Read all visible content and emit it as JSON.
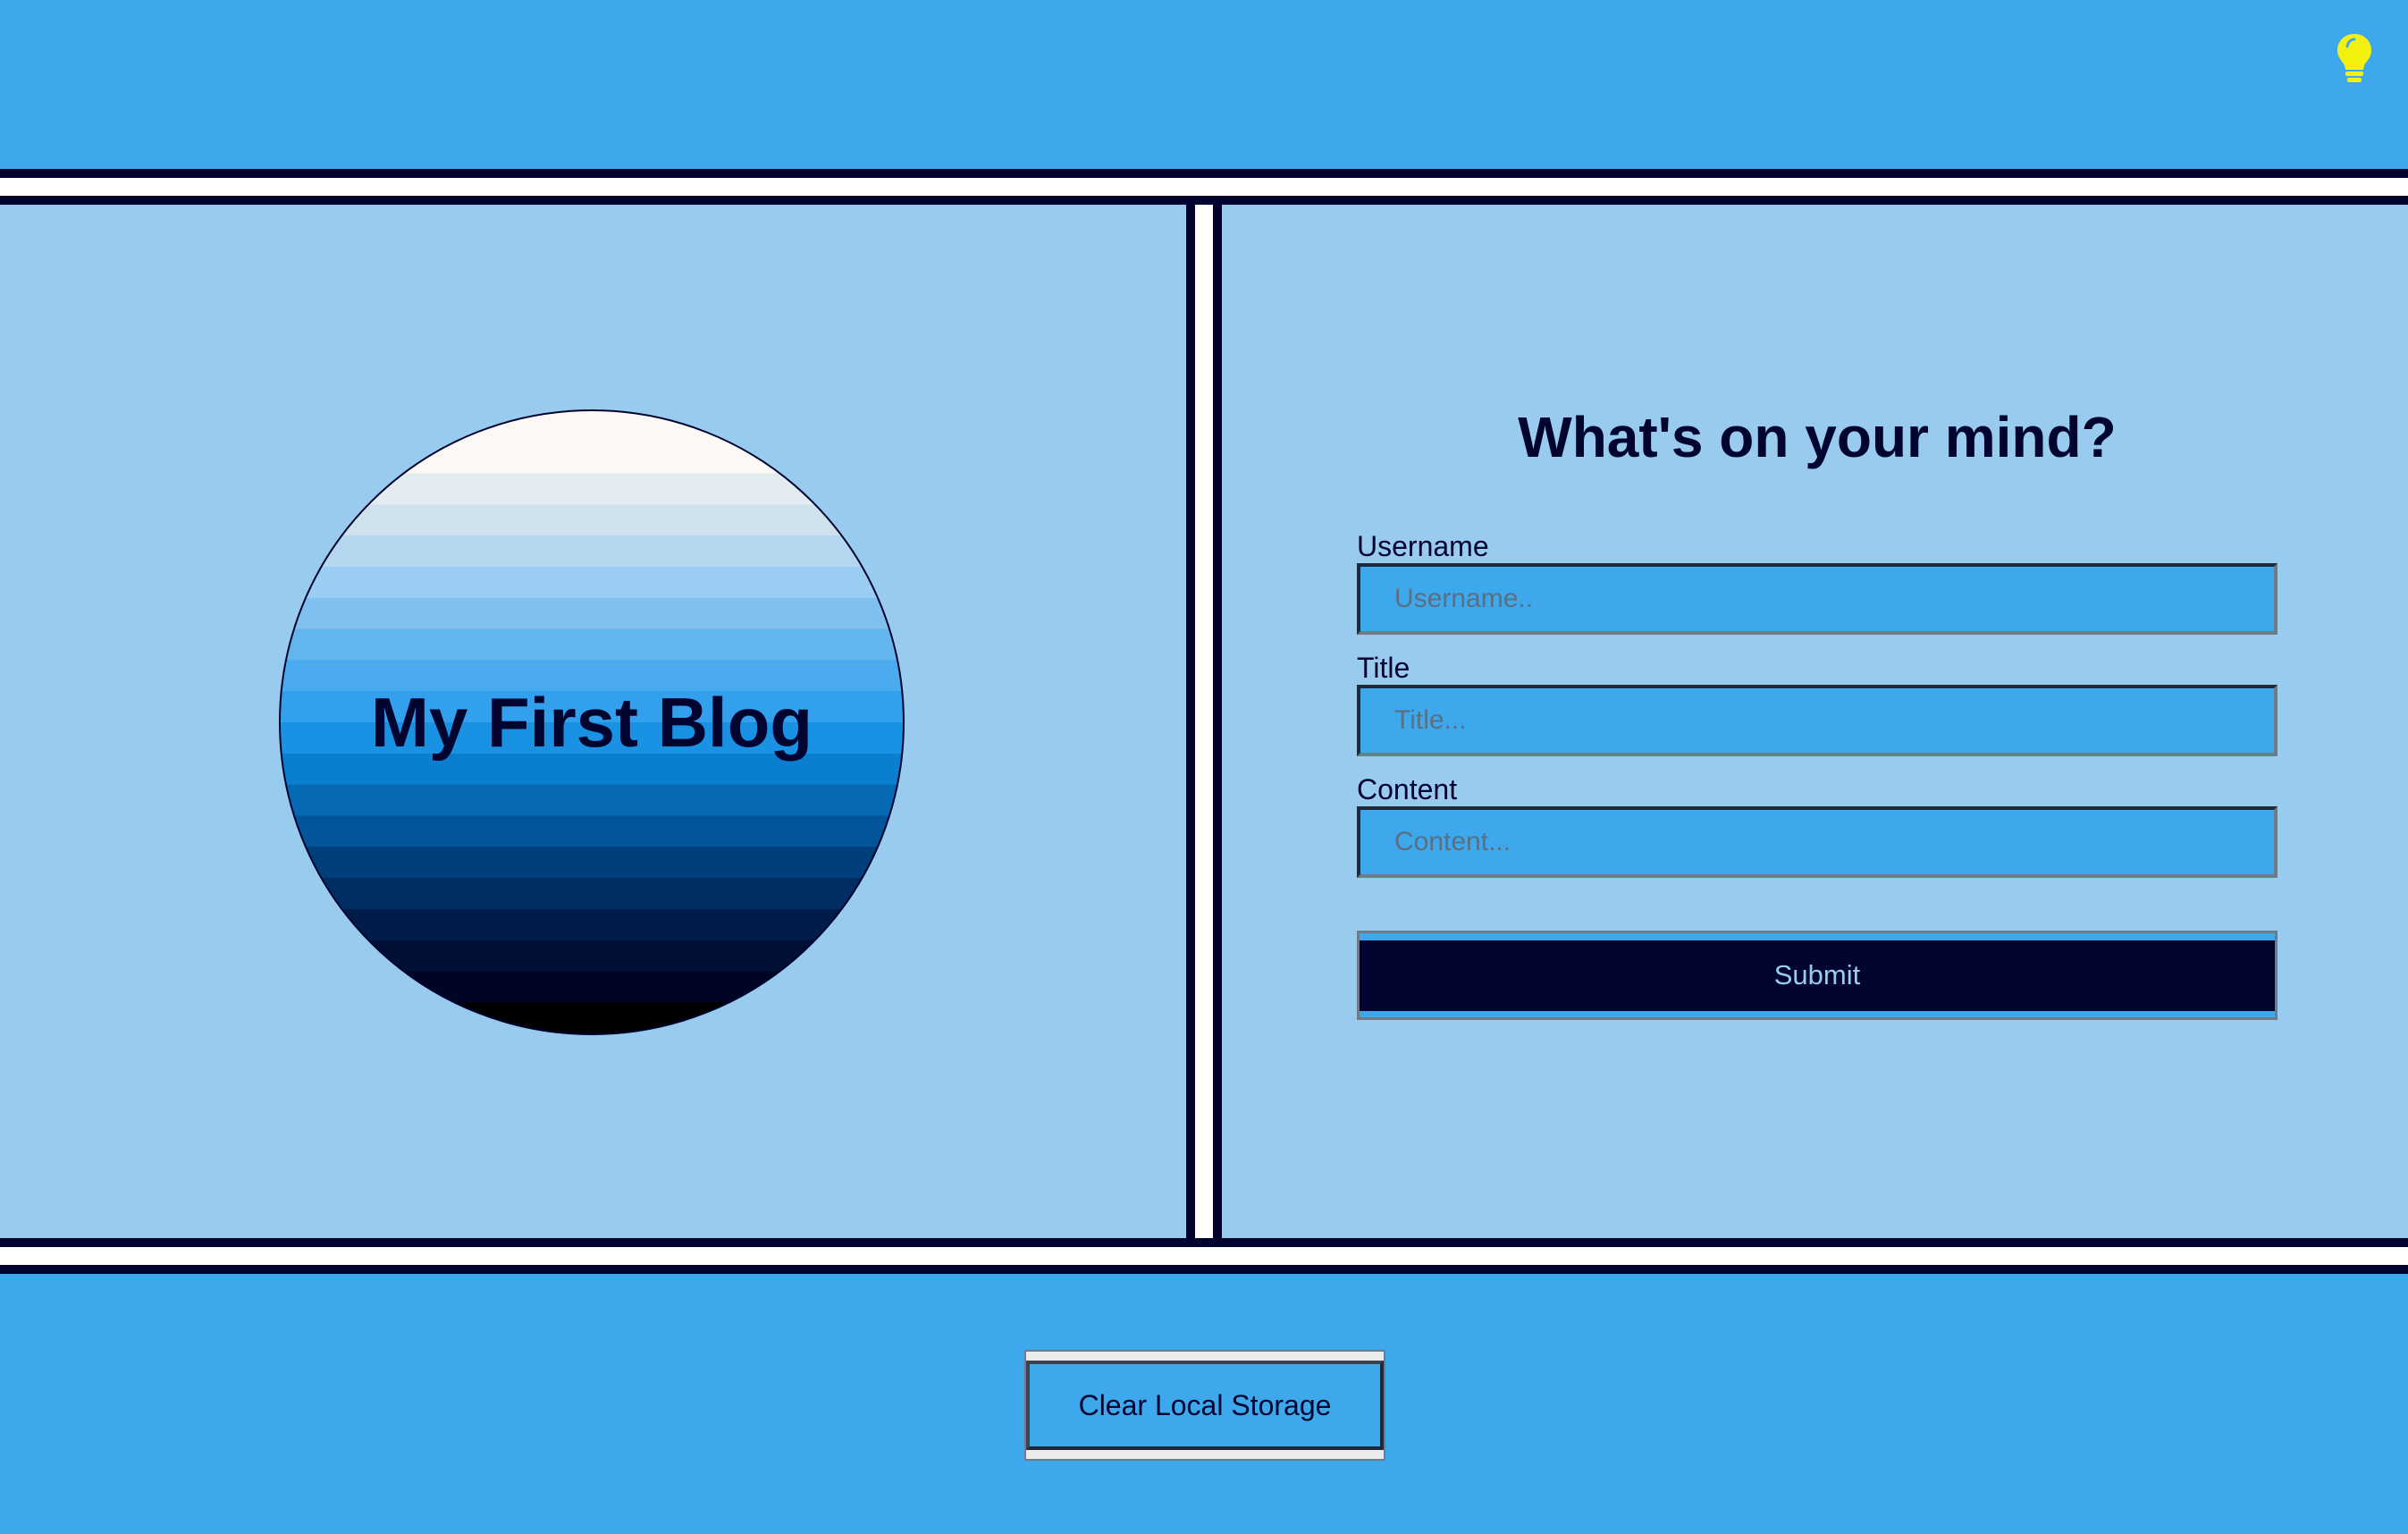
{
  "header": {
    "theme_toggle_icon": "lightbulb-icon",
    "icon_color": "#f5f10f"
  },
  "blog": {
    "title": "My First Blog"
  },
  "form": {
    "heading": "What's on your mind?",
    "username": {
      "label": "Username",
      "placeholder": "Username.."
    },
    "title": {
      "label": "Title",
      "placeholder": "Title..."
    },
    "content": {
      "label": "Content",
      "placeholder": "Content..."
    },
    "submit_label": "Submit"
  },
  "footer": {
    "clear_label": "Clear Local Storage"
  },
  "colors": {
    "primary": "#3da9ec",
    "panel": "#98cbed",
    "navy": "#00042e",
    "accent": "#f5f10f"
  }
}
